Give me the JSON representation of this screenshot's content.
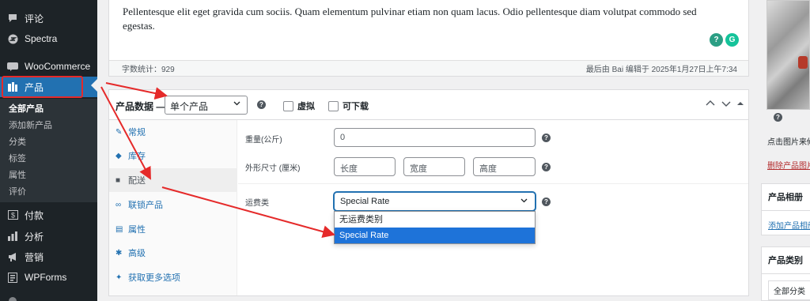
{
  "sidebar": {
    "items": [
      {
        "label": "评论",
        "icon": "comment-icon"
      },
      {
        "label": "Spectra",
        "icon": "spectra-icon"
      },
      {
        "label": "WooCommerce",
        "icon": "woocommerce-icon"
      },
      {
        "label": "产品",
        "icon": "product-icon"
      },
      {
        "label": "付款",
        "icon": "payments-icon"
      },
      {
        "label": "分析",
        "icon": "analytics-icon"
      },
      {
        "label": "营销",
        "icon": "marketing-icon"
      },
      {
        "label": "WPForms",
        "icon": "wpforms-icon"
      }
    ],
    "submenu": [
      "全部产品",
      "添加新产品",
      "分类",
      "标签",
      "属性",
      "评价"
    ]
  },
  "editor": {
    "content": "Pellentesque elit eget gravida cum sociis. Quam elementum pulvinar etiam non quam lacus. Odio pellentesque diam volutpat commodo sed egestas.",
    "word_count": "字数统计：929",
    "last_edited": "最后由 Bai 编辑于 2025年1月27日上午7:34"
  },
  "product_data": {
    "title": "产品数据 —",
    "type_value": "单个产品",
    "virtual_label": "虚拟",
    "downloadable_label": "可下载",
    "tabs": [
      {
        "label": "常规",
        "icon": "wrench-icon"
      },
      {
        "label": "库存",
        "icon": "tag-icon"
      },
      {
        "label": "配送",
        "icon": "truck-icon"
      },
      {
        "label": "联锁产品",
        "icon": "link-icon"
      },
      {
        "label": "属性",
        "icon": "table-icon"
      },
      {
        "label": "高级",
        "icon": "gear-icon"
      },
      {
        "label": "获取更多选项",
        "icon": "plugin-icon"
      }
    ],
    "shipping": {
      "weight_label": "重量(公斤)",
      "weight_placeholder": "0",
      "dimensions_label": "外形尺寸 (厘米)",
      "length_placeholder": "长度",
      "width_placeholder": "宽度",
      "height_placeholder": "高度",
      "class_label": "运费类",
      "class_value": "Special Rate",
      "class_options": [
        "无运费类别",
        "Special Rate"
      ]
    }
  },
  "right_panel": {
    "set_image_text": "点击图片来修改",
    "remove_image": "删除产品图片",
    "gallery_title": "产品相册",
    "add_gallery": "添加产品相册图片",
    "categories_title": "产品类别",
    "all_categories": "全部分类"
  },
  "colors": {
    "sidebar_bg": "#1d2327",
    "accent": "#2271b1",
    "annotation": "#e52a2a",
    "selected_option": "#1e73d9"
  }
}
